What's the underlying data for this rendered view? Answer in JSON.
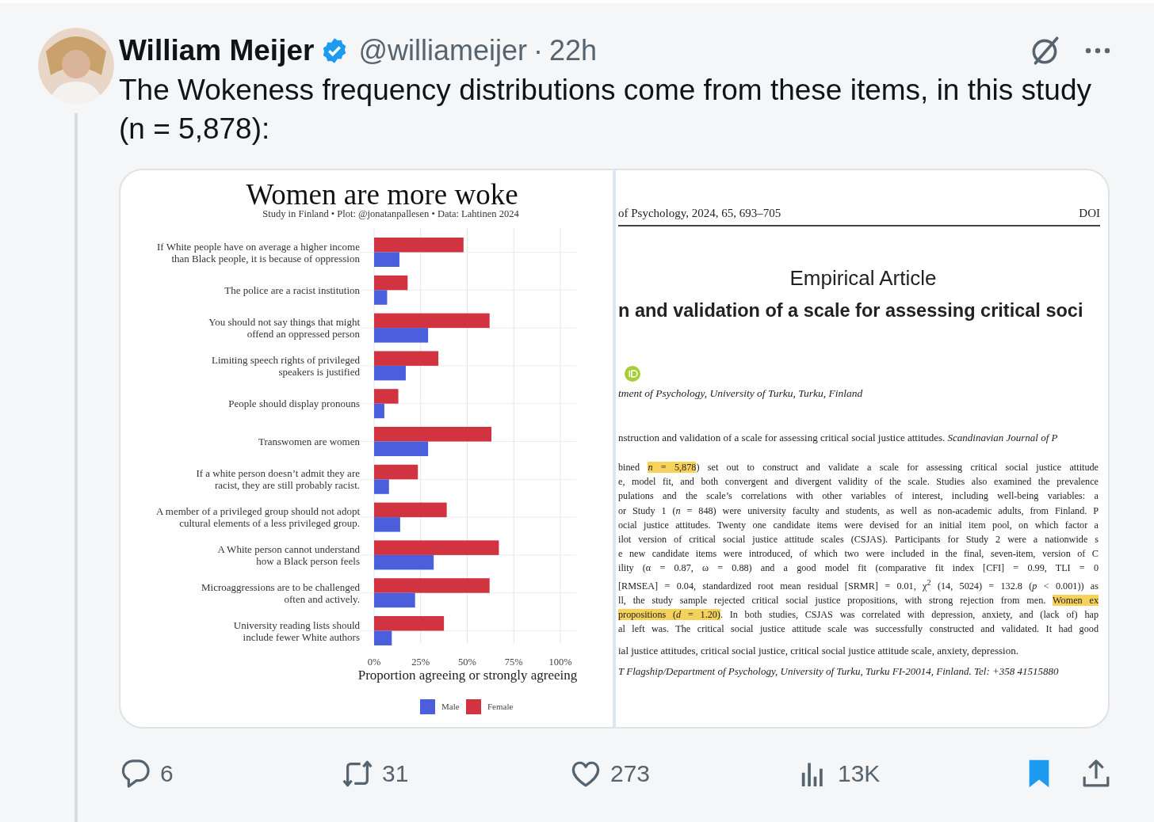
{
  "tweet": {
    "author_name": "William Meijer",
    "verified": true,
    "handle": "@williameijer",
    "separator": "·",
    "time": "22h",
    "text": "The Wokeness frequency distributions come from these items, in this study (n = 5,878):"
  },
  "media": {
    "chart": {
      "chart_data": {
        "type": "bar",
        "orientation": "horizontal",
        "title": "Women are more woke",
        "subtitle": "Study in Finland • Plot: @jonatanpallesen • Data: Lahtinen 2024",
        "xlabel": "Proportion agreeing or strongly agreeing",
        "categories": [
          "If White people have on average a higher income\nthan Black people, it is because of oppression",
          "The police are a racist institution",
          "You should not say things that might\noffend an oppressed person",
          "Limiting speech rights of privileged\nspeakers is justified",
          "People should display pronouns",
          "Transwomen are women",
          "If a white person doesn’t admit they are\nracist, they are still probably racist.",
          "A member of a privileged group should not adopt\ncultural elements of a less privileged group.",
          "A White person cannot understand\nhow a Black person feels",
          "Microaggressions are to be challenged\noften and actively.",
          "University reading lists should\ninclude fewer White authors"
        ],
        "series": [
          {
            "name": "Male",
            "color": "#4b5fdc",
            "values": [
              13.6,
              7,
              29,
              17,
              5.5,
              29,
              8,
              14,
              32,
              22,
              9.5
            ]
          },
          {
            "name": "Female",
            "color": "#d13440",
            "values": [
              48,
              18,
              62,
              34.5,
              13,
              63,
              23.5,
              39,
              67,
              62,
              37.5
            ]
          }
        ],
        "grid": true,
        "legend": true,
        "xlim": [
          0,
          100
        ],
        "xticks": [
          {
            "value": 0,
            "label": "0%"
          },
          {
            "value": 25,
            "label": "25%"
          },
          {
            "value": 50,
            "label": "50%"
          },
          {
            "value": 75,
            "label": "75%"
          },
          {
            "value": 100,
            "label": "100%"
          }
        ]
      }
    },
    "document": {
      "header_left": "of Psychology, 2024, 65, 693–705",
      "header_right": "DOI",
      "section": "Empirical Article",
      "title": "n and validation of a scale for assessing critical soci",
      "affiliation": "tment of Psychology, University of Turku, Turku, Finland",
      "citation": [
        {
          "text": "nstruction and validation of a scale for assessing critical social justice attitudes. *Scandinavian Journal of P*",
          "highlighted": false
        }
      ],
      "abstract_lines": [
        [
          {
            "text": "bined ",
            "highlighted": false
          },
          {
            "text": "*n* = 5,878",
            "highlighted": true
          },
          {
            "text": ") set out to construct and validate a scale for assessing critical social justice attitude",
            "highlighted": false
          }
        ],
        [
          {
            "text": "e, model fit, and both convergent and divergent validity of the scale. Studies also examined the prevalence",
            "highlighted": false
          }
        ],
        [
          {
            "text": "pulations and the scale’s correlations with other variables of interest, including well-being variables: a",
            "highlighted": false
          }
        ],
        [
          {
            "text": "or Study 1 (*n* = 848) were university faculty and students, as well as non-academic adults, from Finland. P",
            "highlighted": false
          }
        ],
        [
          {
            "text": "ocial justice attitudes. Twenty one candidate items were devised for an initial item pool, on which factor a",
            "highlighted": false
          }
        ],
        [
          {
            "text": "ilot version of critical social justice attitude scales (CSJAS). Participants for Study 2 were a nationwide s",
            "highlighted": false
          }
        ],
        [
          {
            "text": "e new candidate items were introduced, of which two were included in the final, seven-item, version of C",
            "highlighted": false
          }
        ],
        [
          {
            "text": "ility (α = 0.87, ω = 0.88) and a good model fit (comparative fit index [CFI] = 0.99, TLI = 0",
            "highlighted": false
          }
        ],
        [
          {
            "text": "[RMSEA] = 0.04, standardized root mean residual [SRMR] = 0.01, χ$^{2}$ (14, 5024) = 132.8 (*p* < 0.001)) as",
            "highlighted": false
          }
        ],
        [
          {
            "text": "ll, the study sample rejected critical social justice propositions, with strong rejection from men. ",
            "highlighted": false
          },
          {
            "text": "Women ex",
            "highlighted": true
          }
        ],
        [
          {
            "text": "propositions (*d* = 1.20)",
            "highlighted": true
          },
          {
            "text": ". In both studies, CSJAS was correlated with depression, anxiety, and (lack of) hap",
            "highlighted": false
          }
        ],
        [
          {
            "text": "al left was. The critical social justice attitude scale was successfully constructed and validated. It had good",
            "highlighted": false
          }
        ]
      ],
      "keywords": "ial justice attitudes, critical social justice, critical social justice attitude scale, anxiety, depression.",
      "footer": "T Flagship/Department of Psychology, University of Turku, Turku FI-20014, Finland. Tel: +358 41515880"
    }
  },
  "actions": [
    {
      "kind": "reply",
      "count": "6"
    },
    {
      "kind": "repost",
      "count": "31"
    },
    {
      "kind": "like",
      "count": "273"
    },
    {
      "kind": "views",
      "count": "13K"
    },
    {
      "kind": "bookmark",
      "bookmarked": true
    },
    {
      "kind": "share"
    }
  ]
}
